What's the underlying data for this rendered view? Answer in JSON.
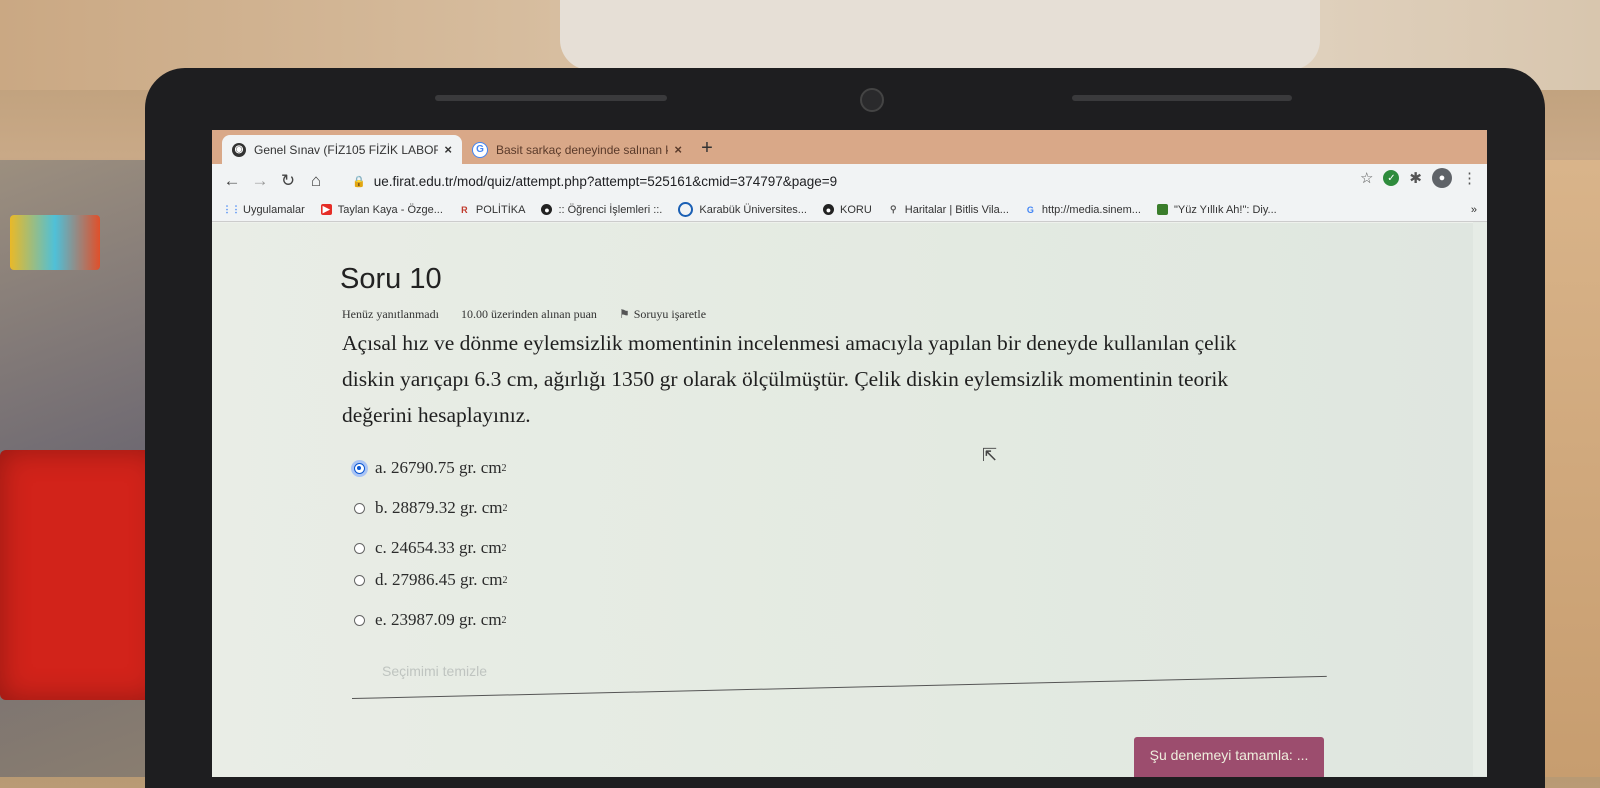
{
  "browser": {
    "tabs": [
      {
        "title": "Genel Sınav (FİZ105 FİZİK LABOR...",
        "icon": "moodle-icon",
        "active": true
      },
      {
        "title": "Basit sarkaç deneyinde salınan k...",
        "icon": "google-icon",
        "active": false
      }
    ],
    "new_tab": "+",
    "close": "×",
    "url": "ue.firat.edu.tr/mod/quiz/attempt.php?attempt=525161&cmid=374797&page=9",
    "bookmarks": [
      {
        "label": "Uygulamalar",
        "icon": "apps-grid-icon"
      },
      {
        "label": "Taylan Kaya - Özge...",
        "icon": "youtube-icon"
      },
      {
        "label": "POLİTİKA",
        "icon": "r-logo-icon"
      },
      {
        "label": ":: Öğrenci İşlemleri ::.",
        "icon": "site-icon"
      },
      {
        "label": "Karabük Üniversites...",
        "icon": "site-icon"
      },
      {
        "label": "KORU",
        "icon": "site-icon"
      },
      {
        "label": "Haritalar | Bitlis Vila...",
        "icon": "maps-icon"
      },
      {
        "label": "http://media.sinem...",
        "icon": "google-icon"
      },
      {
        "label": "\"Yüz Yıllık Ah!\": Diy...",
        "icon": "bookmark-icon"
      }
    ],
    "more_bookmarks": "»"
  },
  "question": {
    "heading": "Soru 10",
    "status": "Henüz yanıtlanmadı",
    "points": "10.00 üzerinden alınan puan",
    "flag": "Soruyu işaretle",
    "text": "Açısal hız ve dönme eylemsizlik momentinin incelenmesi amacıyla yapılan bir deneyde kullanılan çelik diskin yarıçapı 6.3 cm, ağırlığı 1350 gr olarak ölçülmüştür. Çelik diskin eylemsizlik momentinin teorik değerini hesaplayınız.",
    "answers": [
      {
        "label": "a. 26790.75 gr. cm",
        "selected": true
      },
      {
        "label": "b. 28879.32 gr. cm",
        "selected": false
      },
      {
        "label": "c. 24654.33 gr. cm",
        "selected": false
      },
      {
        "label": "d. 27986.45 gr. cm",
        "selected": false
      },
      {
        "label": "e. 23987.09 gr. cm",
        "selected": false
      }
    ],
    "exponent": "2",
    "clear_choice": "Seçimimi temizle",
    "finish_button": "Şu denemeyi tamamla: ..."
  },
  "colors": {
    "tab_bar": "#d9a888",
    "finish_button": "#9c4d6e",
    "radio_selected": "#0b57d0"
  }
}
